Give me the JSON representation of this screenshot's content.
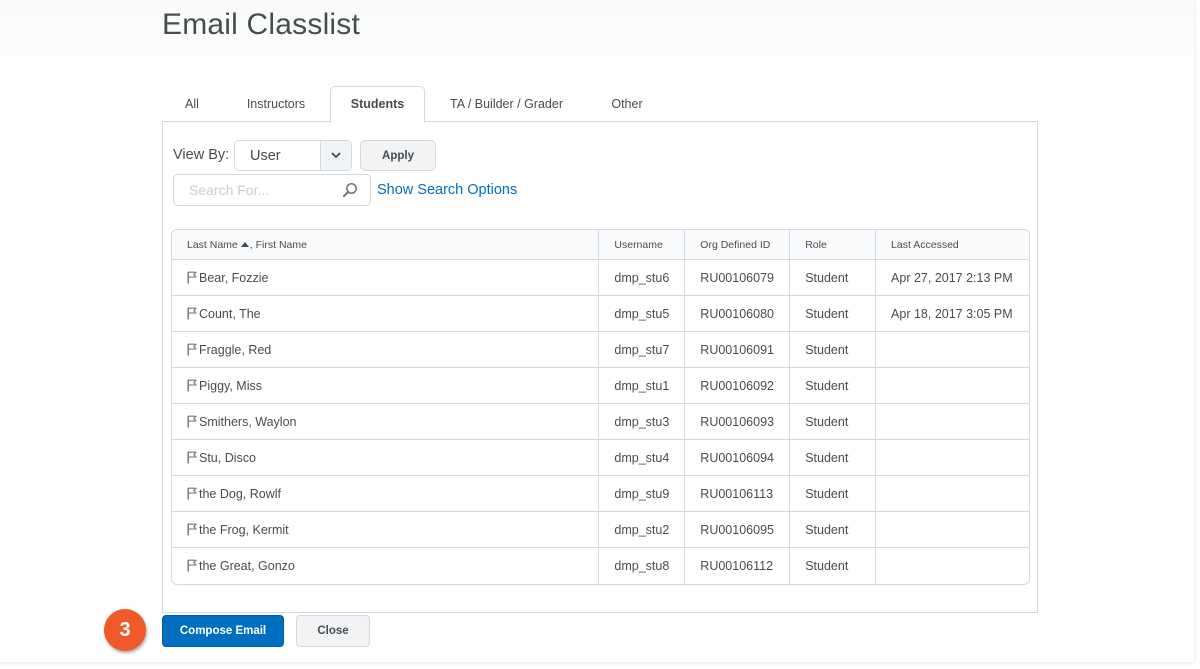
{
  "page": {
    "title": "Email Classlist"
  },
  "tabs": [
    {
      "label": "All",
      "selected": false
    },
    {
      "label": "Instructors",
      "selected": false
    },
    {
      "label": "Students",
      "selected": true
    },
    {
      "label": "TA / Builder / Grader",
      "selected": false
    },
    {
      "label": "Other",
      "selected": false
    }
  ],
  "filters": {
    "view_by_label": "View By:",
    "view_by_value": "User",
    "apply_label": "Apply",
    "search_placeholder": "Search For...",
    "search_value": "",
    "show_search_options": "Show Search Options"
  },
  "table": {
    "columns": {
      "name_last": "Last Name",
      "name_sep": ", First Name",
      "username": "Username",
      "org_id": "Org Defined ID",
      "role": "Role",
      "last_accessed": "Last Accessed"
    },
    "sort": {
      "column": "Last Name",
      "direction": "ascending"
    },
    "rows": [
      {
        "name": "Bear, Fozzie",
        "username": "dmp_stu6",
        "org_id": "RU00106079",
        "role": "Student",
        "last_accessed": "Apr 27, 2017 2:13 PM"
      },
      {
        "name": "Count, The",
        "username": "dmp_stu5",
        "org_id": "RU00106080",
        "role": "Student",
        "last_accessed": "Apr 18, 2017 3:05 PM"
      },
      {
        "name": "Fraggle, Red",
        "username": "dmp_stu7",
        "org_id": "RU00106091",
        "role": "Student",
        "last_accessed": ""
      },
      {
        "name": "Piggy, Miss",
        "username": "dmp_stu1",
        "org_id": "RU00106092",
        "role": "Student",
        "last_accessed": ""
      },
      {
        "name": "Smithers, Waylon",
        "username": "dmp_stu3",
        "org_id": "RU00106093",
        "role": "Student",
        "last_accessed": ""
      },
      {
        "name": "Stu, Disco",
        "username": "dmp_stu4",
        "org_id": "RU00106094",
        "role": "Student",
        "last_accessed": ""
      },
      {
        "name": "the Dog, Rowlf",
        "username": "dmp_stu9",
        "org_id": "RU00106113",
        "role": "Student",
        "last_accessed": ""
      },
      {
        "name": "the Frog, Kermit",
        "username": "dmp_stu2",
        "org_id": "RU00106095",
        "role": "Student",
        "last_accessed": ""
      },
      {
        "name": "the Great, Gonzo",
        "username": "dmp_stu8",
        "org_id": "RU00106112",
        "role": "Student",
        "last_accessed": ""
      }
    ]
  },
  "footer": {
    "step_badge": "3",
    "compose_label": "Compose Email",
    "close_label": "Close"
  },
  "colors": {
    "primary": "#006fbf",
    "badge": "#f05a28",
    "border": "#d3d9e3",
    "text": "#494c4e"
  },
  "icons": {
    "row_icon": "flag-icon",
    "search": "search-icon",
    "dropdown": "chevron-down-icon",
    "sort": "sort-ascending-icon"
  }
}
